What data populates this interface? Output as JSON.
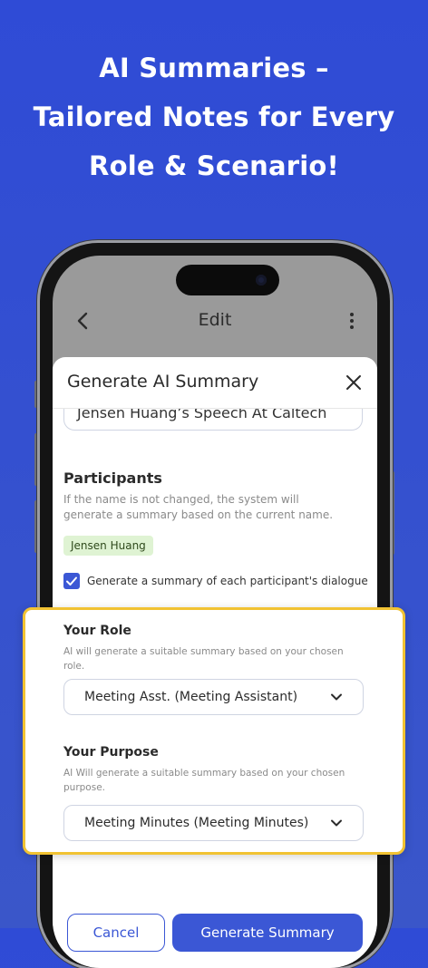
{
  "headline": {
    "line1": "AI Summaries –",
    "line2": "Tailored Notes for Every",
    "line3": "Role & Scenario!"
  },
  "appbar": {
    "title": "Edit"
  },
  "sheet": {
    "title": "Generate AI Summary",
    "name_value": "Jensen Huang’s Speech At Caltech",
    "participants": {
      "heading": "Participants",
      "description": "If the name is not changed, the system will generate a summary based on the current name.",
      "chip": "Jensen Huang",
      "checkbox_label": "Generate a summary of each participant's dialogue",
      "checkbox_checked": true
    },
    "cancel_label": "Cancel",
    "generate_label": "Generate Summary"
  },
  "callout": {
    "role_heading": "Your Role",
    "role_description": "AI will generate a suitable summary based on your chosen role.",
    "role_value": "Meeting Asst. (Meeting Assistant)",
    "purpose_heading": "Your Purpose",
    "purpose_description": "AI Will generate a suitable summary based on your chosen purpose.",
    "purpose_value": "Meeting Minutes (Meeting Minutes)"
  },
  "colors": {
    "background": "#2f4bd6",
    "accent": "#3b57d5",
    "highlight_border": "#f1c232",
    "chip_bg": "#dff3d3"
  },
  "icons": [
    "back-icon",
    "more-icon",
    "close-icon",
    "check-icon",
    "chevron-down-icon"
  ]
}
